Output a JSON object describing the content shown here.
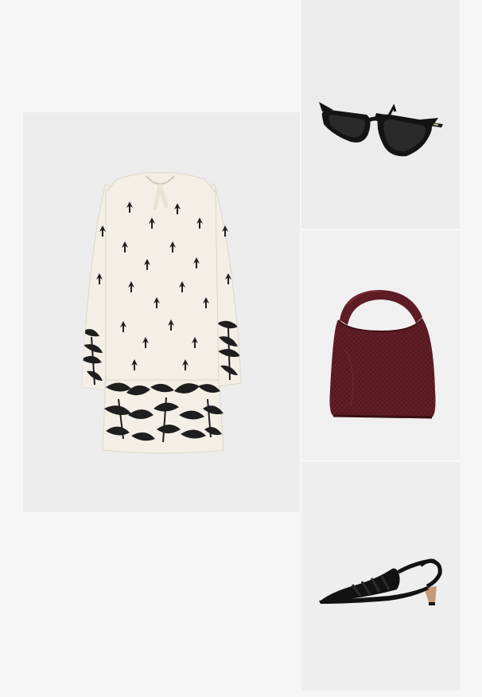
{
  "outfit": {
    "items": [
      {
        "id": "dress",
        "icon": "dress-icon",
        "kind": "printed tunic dress"
      },
      {
        "id": "glasses",
        "icon": "sunglasses-icon",
        "kind": "cat-eye sunglasses"
      },
      {
        "id": "bag",
        "icon": "handbag-icon",
        "kind": "woven leather hobo bag"
      },
      {
        "id": "shoe",
        "icon": "slingback-icon",
        "kind": "slingback pump"
      }
    ]
  },
  "colors": {
    "page_background": "#f6f6f6",
    "tile_background": "#ececec",
    "dress_base": "#f3efe6",
    "dress_print": "#1e1e1e",
    "bag_color": "#5e1c24",
    "glasses_color": "#141414",
    "shoe_color": "#121212",
    "heel_color": "#c69a76"
  }
}
